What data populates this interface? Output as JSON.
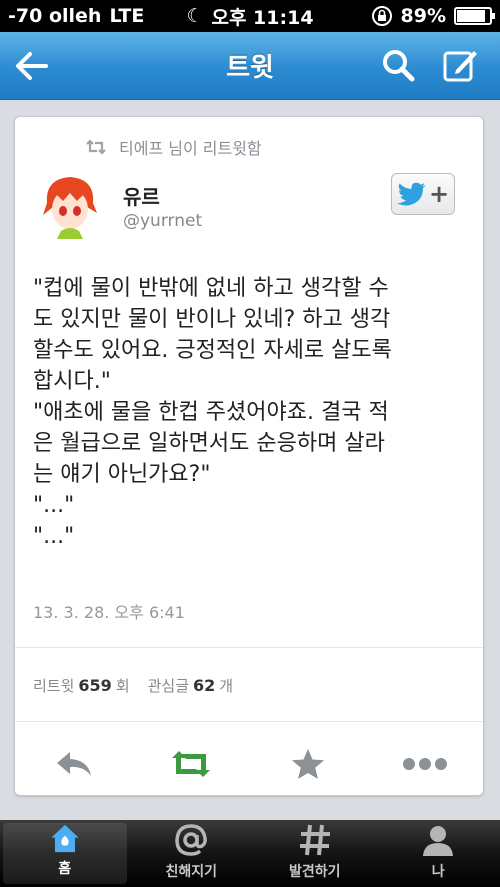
{
  "status": {
    "carrier": "-70 olleh",
    "network": "LTE",
    "time": "오후 11:14",
    "battery": "89%",
    "battery_level": 0.89
  },
  "nav": {
    "title": "트윗",
    "back_icon": "back-arrow-icon",
    "search_icon": "search-icon",
    "compose_icon": "compose-icon"
  },
  "tweet": {
    "retweeted_by": "티에프 님이 리트윗함",
    "name": "유르",
    "handle": "@yurrnet",
    "text": "\"컵에 물이 반밖에 없네 하고 생각할 수\n도 있지만 물이 반이나 있네? 하고 생각\n할수도 있어요. 긍정적인 자세로 살도록\n합시다.\"\n\"애초에 물을 한컵 주셨어야죠. 결국 적\n은 월급으로 일하면서도 순응하며 살라\n는 얘기 아닌가요?\"\n\"...\"\n\"...\"",
    "timestamp": "13. 3. 28. 오후 6:41",
    "retweet_label": "리트윗",
    "retweet_count": "659",
    "retweet_unit": "회",
    "fav_label": "관심글",
    "fav_count": "62",
    "fav_unit": "개"
  },
  "tabs": [
    {
      "label": "홈",
      "icon": "home-icon",
      "active": true
    },
    {
      "label": "친해지기",
      "icon": "at-icon",
      "active": false
    },
    {
      "label": "발견하기",
      "icon": "hash-icon",
      "active": false
    },
    {
      "label": "나",
      "icon": "person-icon",
      "active": false
    }
  ],
  "colors": {
    "accent": "#2b8bd1",
    "retweet_green": "#3c9a3f"
  }
}
